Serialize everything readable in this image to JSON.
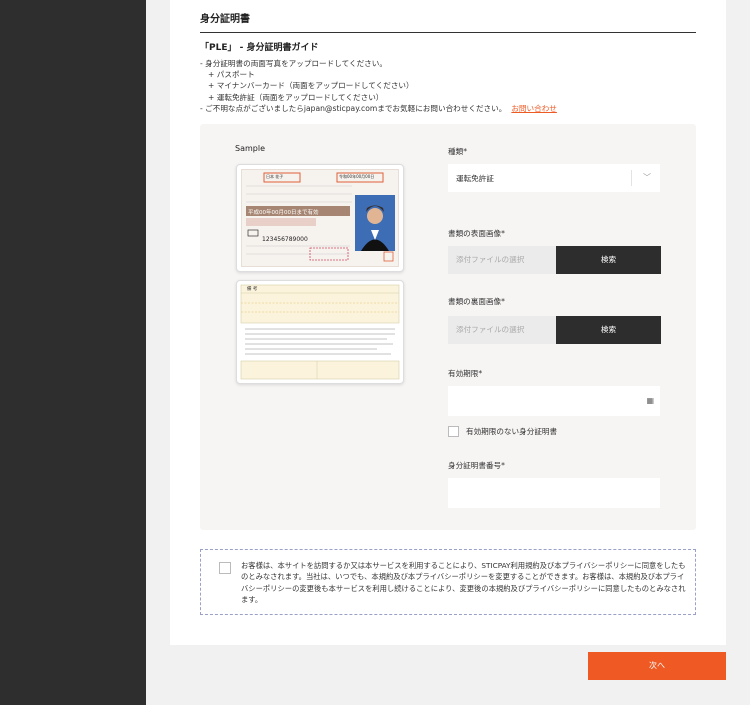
{
  "section": {
    "title": "身分証明書"
  },
  "guide": {
    "title": "「PLE」 - 身分証明書ガイド",
    "lines": [
      "- 身分証明書の両面写真をアップロードしてください。",
      "+ パスポート",
      "+ マイナンバーカード（両面をアップロードしてください）",
      "+ 運転免許証（両面をアップロードしてください）"
    ],
    "contact_text": "- ご不明な点がございましたらjapan@sticpay.comまでお気軽にお問い合わせください。",
    "contact_link": "お問い合わせ"
  },
  "sample": {
    "label": "Sample",
    "front": {
      "number": "123456789000",
      "name_box": "日本 花子",
      "date_box": "令和00年00月00日",
      "banner": "平成00年00月00日まで有効"
    },
    "back": {
      "header": "備 考"
    }
  },
  "form": {
    "type_label": "種類",
    "type_value": "運転免許証",
    "front_label": "書類の表面画像",
    "back_label": "書類の裏面画像",
    "file_placeholder": "添付ファイルの選択",
    "browse_label": "検索",
    "expiry_label": "有効期限",
    "no_expiry_label": "有効期限のない身分証明書",
    "id_number_label": "身分証明書番号",
    "required_mark": "*"
  },
  "terms": {
    "text": "お客様は、本サイトを訪問するか又は本サービスを利用することにより、STICPAY利用規約及び本プライバシーポリシーに同意をしたものとみなされます。当社は、いつでも、本規約及び本プライバシーポリシーを変更することができます。お客様は、本規約及び本プライバシーポリシーの変更後も本サービスを利用し続けることにより、変更後の本規約及びプライバシーポリシーに同意したものとみなされます。"
  },
  "next_label": "次へ",
  "colors": {
    "accent": "#ef5a24",
    "dark_button": "#2d2d2d",
    "sidebar": "#2e2e2e"
  },
  "icons": {
    "dropdown": "chevron-down-icon",
    "date": "calendar-icon"
  }
}
